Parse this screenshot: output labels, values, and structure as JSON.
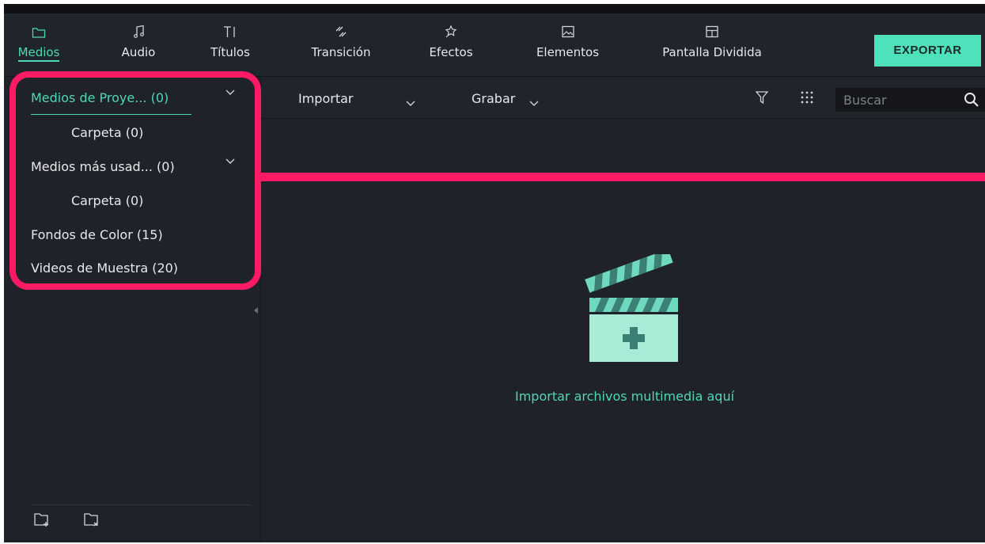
{
  "toolbar": {
    "tabs": [
      {
        "label": "Medios",
        "icon": "folder-icon",
        "active": true
      },
      {
        "label": "Audio",
        "icon": "music-note-icon",
        "active": false
      },
      {
        "label": "Títulos",
        "icon": "text-icon",
        "active": false
      },
      {
        "label": "Transición",
        "icon": "transition-icon",
        "active": false
      },
      {
        "label": "Efectos",
        "icon": "sparkle-icon",
        "active": false
      },
      {
        "label": "Elementos",
        "icon": "image-icon",
        "active": false
      },
      {
        "label": "Pantalla Dividida",
        "icon": "split-screen-icon",
        "active": false
      }
    ],
    "export_label": "EXPORTAR"
  },
  "sidebar": {
    "items": [
      {
        "label": "Medios de Proye... (0)",
        "selected": true,
        "expandable": true
      },
      {
        "label": "Carpeta (0)",
        "indent": true
      },
      {
        "label": "Medios más usad... (0)",
        "expandable": true
      },
      {
        "label": "Carpeta (0)",
        "indent": true
      },
      {
        "label": "Fondos de Color (15)"
      },
      {
        "label": "Videos de Muestra (20)"
      }
    ],
    "footer_icons": [
      "new-folder-icon",
      "delete-folder-icon"
    ]
  },
  "subbar": {
    "import_label": "Importar",
    "record_label": "Grabar",
    "search_placeholder": "Buscar",
    "icons": [
      "filter-icon",
      "grid-view-icon",
      "search-icon"
    ]
  },
  "content": {
    "hint": "Importar archivos multimedia aquí",
    "illustration": "clapperboard-add-icon"
  },
  "colors": {
    "accent": "#4fd6b8",
    "export_button": "#4fe0bc",
    "annotation": "#ff1a66",
    "background": "#1f2229"
  }
}
